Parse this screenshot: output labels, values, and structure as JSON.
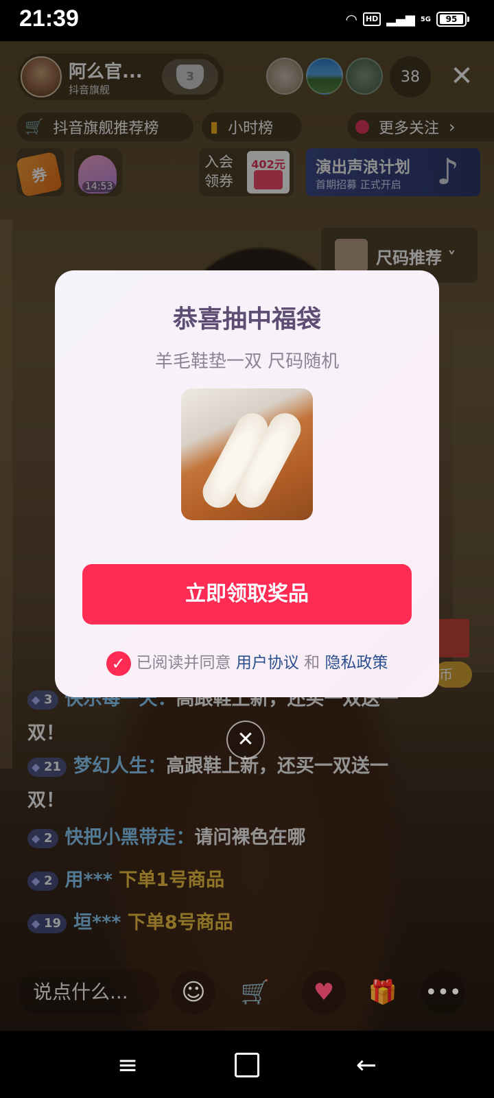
{
  "status": {
    "time": "21:39",
    "network": "5G",
    "hd": "HD",
    "battery": "95"
  },
  "header": {
    "host_name": "阿么官...",
    "host_sub": "抖音旗舰",
    "fans_level": "3",
    "viewer_count": "38"
  },
  "pills": {
    "rank": "抖音旗舰推荐榜",
    "hourly": "小时榜",
    "more_follow": "更多关注"
  },
  "row2": {
    "bag1_label": "券",
    "bag2_timer": "14:53",
    "coupon_text1": "入会",
    "coupon_text2": "领券",
    "coupon_amount": "402元",
    "promo_title": "演出声浪计划",
    "promo_sub": "首期招募 正式开启",
    "size_rec": "尺码推荐"
  },
  "side": {
    "coin": "币"
  },
  "chat": [
    {
      "level": "3",
      "user": "快乐每一天：",
      "msg": "高跟鞋上新，还买一双送一双！"
    },
    {
      "level": "21",
      "user": "梦幻人生：",
      "msg": "高跟鞋上新，还买一双送一双！"
    },
    {
      "level": "2",
      "user": "快把小黑带走：",
      "msg": "请问裸色在哪"
    },
    {
      "level": "2",
      "user": "用***",
      "msg": "下单1号商品"
    },
    {
      "level": "19",
      "user": "垣***",
      "msg": "下单8号商品"
    }
  ],
  "bottom": {
    "say_placeholder": "说点什么..."
  },
  "modal": {
    "title": "恭喜抽中福袋",
    "subtitle": "羊毛鞋垫一双 尺码随机",
    "claim_button": "立即领取奖品",
    "agree_prefix": "已阅读并同意",
    "user_agreement": "用户协议",
    "and": "和",
    "privacy_policy": "隐私政策"
  },
  "colors": {
    "accent": "#fe2c55",
    "title": "#5e4d72",
    "link": "#2a4f8f"
  }
}
